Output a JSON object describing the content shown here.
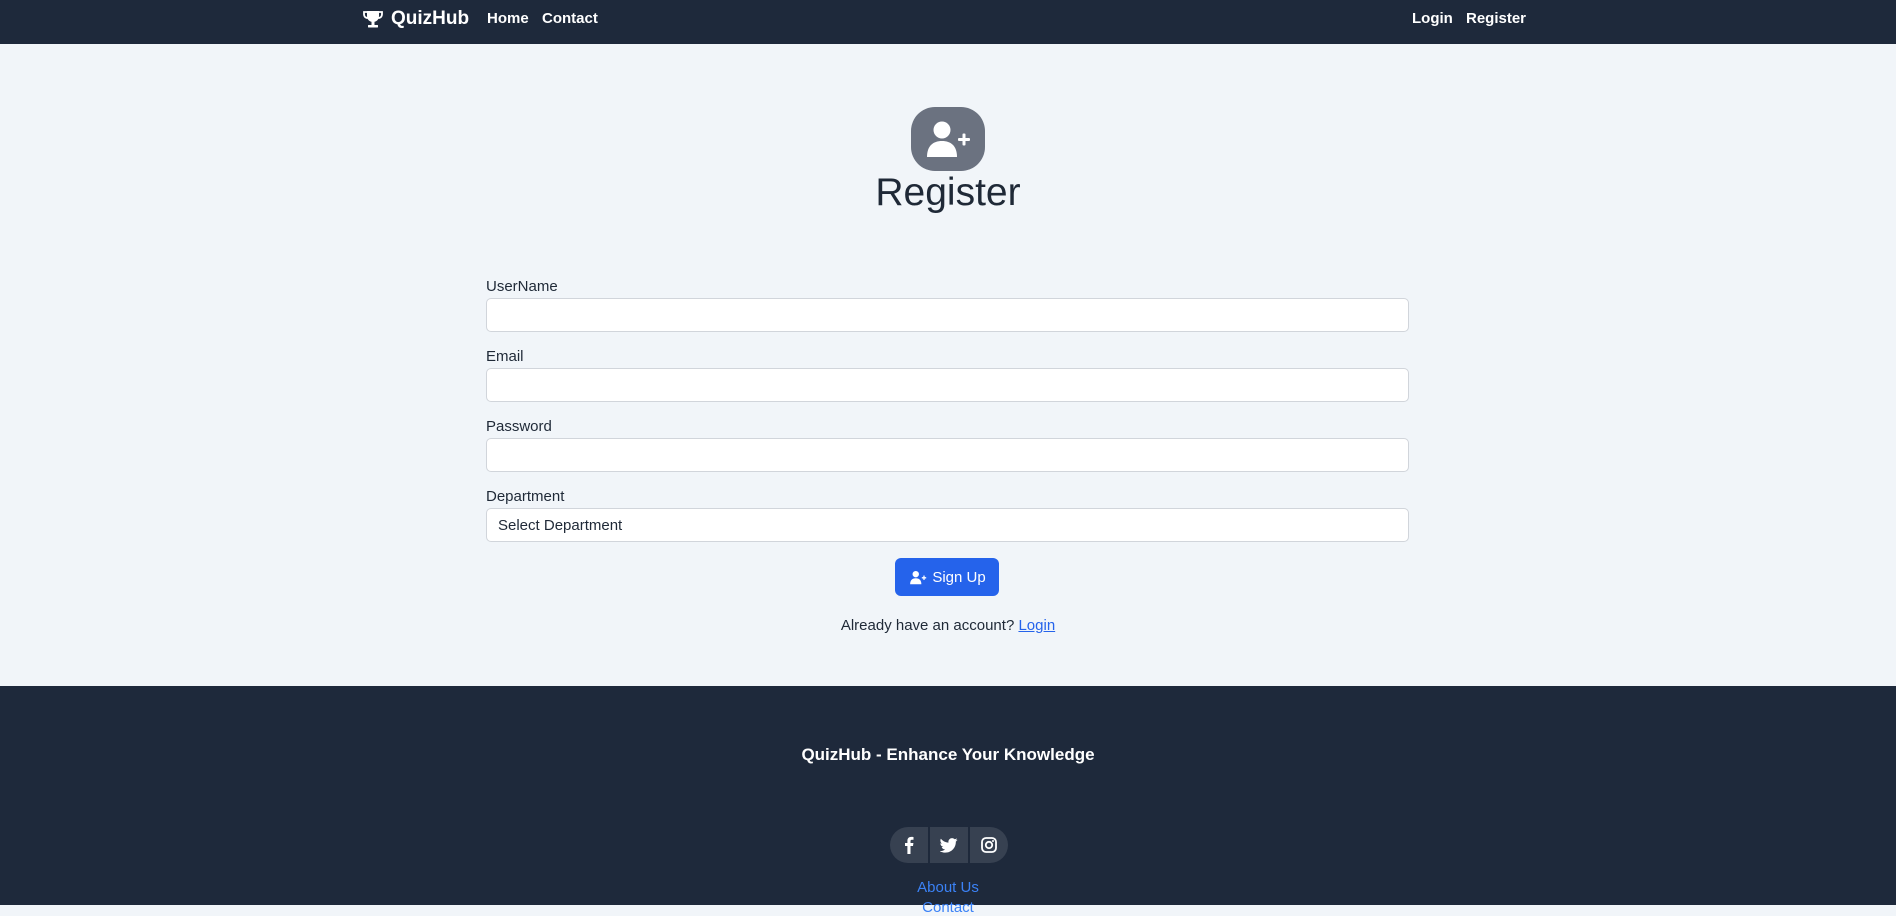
{
  "nav": {
    "brand": "QuizHub",
    "home": "Home",
    "contact": "Contact",
    "login": "Login",
    "register": "Register"
  },
  "header": {
    "icon": "user-plus-icon",
    "title": "Register"
  },
  "form": {
    "username_label": "UserName",
    "username_value": "",
    "email_label": "Email",
    "email_value": "",
    "password_label": "Password",
    "password_value": "",
    "department_label": "Department",
    "department_selected": "Select Department",
    "signup_label": "Sign Up",
    "already_text": "Already have an account?",
    "login_link": "Login"
  },
  "footer": {
    "title": "QuizHub - Enhance Your Knowledge",
    "social": [
      "facebook-icon",
      "twitter-icon",
      "instagram-icon"
    ],
    "links": [
      "About Us",
      "Contact"
    ]
  },
  "colors": {
    "navbar": "#1e293b",
    "background": "#f1f5f9",
    "primary": "#2563eb",
    "avatar": "#6b7280"
  }
}
